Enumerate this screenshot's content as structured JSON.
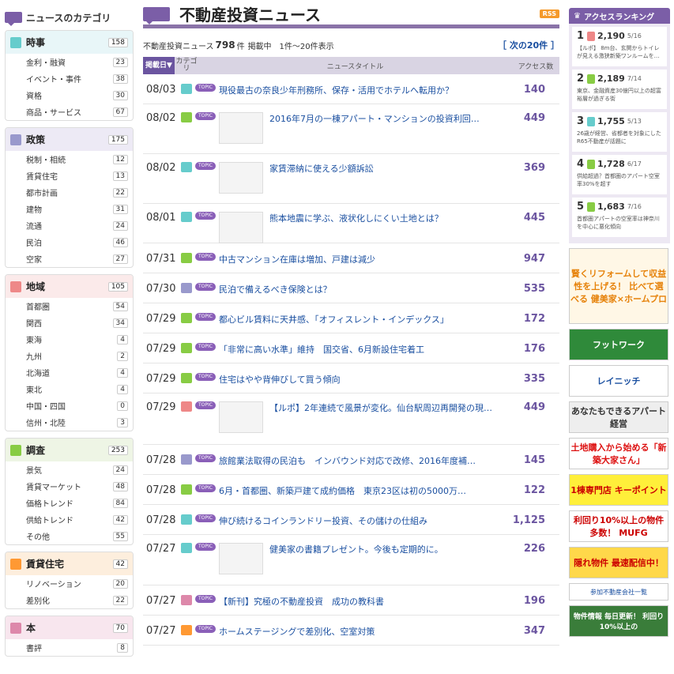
{
  "sidebar": {
    "title": "ニュースのカテゴリ",
    "categories": [
      {
        "name": "時事",
        "count": "158",
        "color": "#6cc",
        "ic": "時事",
        "bg": "#e8f6f8",
        "items": [
          {
            "label": "金利・融資",
            "count": "23"
          },
          {
            "label": "イベント・事件",
            "count": "38"
          },
          {
            "label": "資格",
            "count": "30"
          },
          {
            "label": "商品・サービス",
            "count": "67"
          }
        ]
      },
      {
        "name": "政策",
        "count": "175",
        "color": "#99c",
        "ic": "政策",
        "bg": "#edeaf5",
        "items": [
          {
            "label": "税制・相続",
            "count": "12"
          },
          {
            "label": "賃貸住宅",
            "count": "13"
          },
          {
            "label": "都市計画",
            "count": "22"
          },
          {
            "label": "建物",
            "count": "31"
          },
          {
            "label": "流通",
            "count": "24"
          },
          {
            "label": "民泊",
            "count": "46"
          },
          {
            "label": "空家",
            "count": "27"
          }
        ]
      },
      {
        "name": "地域",
        "count": "105",
        "color": "#e88",
        "ic": "地域",
        "bg": "#fbeaea",
        "items": [
          {
            "label": "首都圏",
            "count": "54"
          },
          {
            "label": "関西",
            "count": "34"
          },
          {
            "label": "東海",
            "count": "4"
          },
          {
            "label": "九州",
            "count": "2"
          },
          {
            "label": "北海道",
            "count": "4"
          },
          {
            "label": "東北",
            "count": "4"
          },
          {
            "label": "中国・四国",
            "count": "0"
          },
          {
            "label": "信州・北陸",
            "count": "3"
          }
        ]
      },
      {
        "name": "調査",
        "count": "253",
        "color": "#8c4",
        "ic": "調査",
        "bg": "#eef5e5",
        "items": [
          {
            "label": "景気",
            "count": "24"
          },
          {
            "label": "賃貸マーケット",
            "count": "48"
          },
          {
            "label": "価格トレンド",
            "count": "84"
          },
          {
            "label": "供給トレンド",
            "count": "42"
          },
          {
            "label": "その他",
            "count": "55"
          }
        ]
      },
      {
        "name": "賃貸住宅",
        "count": "42",
        "color": "#f93",
        "ic": "賃貸住宅",
        "bg": "#fdeedd",
        "items": [
          {
            "label": "リノベーション",
            "count": "20"
          },
          {
            "label": "差別化",
            "count": "22"
          }
        ]
      },
      {
        "name": "本",
        "count": "70",
        "color": "#d8a",
        "ic": "本",
        "bg": "#f8e6ee",
        "items": [
          {
            "label": "書評",
            "count": "8"
          }
        ]
      }
    ]
  },
  "main": {
    "title": "不動産投資ニュース",
    "rss": "RSS",
    "count_prefix": "不動産投資ニュース",
    "count_num": "798",
    "count_unit": "件",
    "count_suffix": "掲載中　1件〜20件表示",
    "next": "［ 次の20件 ］",
    "head": {
      "date": "掲載日▼",
      "cat": "カテゴリ",
      "title": "ニュースタイトル",
      "access": "アクセス数"
    },
    "rows": [
      {
        "date": "08/03",
        "color": "#6cc",
        "title": "現役最古の奈良少年刑務所、保存・活用でホテルへ転用か？",
        "access": "140",
        "thumb": false
      },
      {
        "date": "08/02",
        "color": "#8c4",
        "title": "2016年7月の一棟アパート・マンションの投資利回…",
        "access": "449",
        "thumb": true
      },
      {
        "date": "08/02",
        "color": "#6cc",
        "title": "家賃滞納に使える少額訴訟",
        "access": "369",
        "thumb": true
      },
      {
        "date": "08/01",
        "color": "#6cc",
        "title": "熊本地震に学ぶ、液状化しにくい土地とは？",
        "access": "445",
        "thumb": true
      },
      {
        "date": "07/31",
        "color": "#8c4",
        "title": "中古マンション在庫は増加、戸建は減少",
        "access": "947",
        "thumb": false
      },
      {
        "date": "07/30",
        "color": "#99c",
        "title": "民泊で備えるべき保険とは？",
        "access": "535",
        "thumb": false
      },
      {
        "date": "07/29",
        "color": "#8c4",
        "title": "都心ビル賃料に天井感、「オフィスレント・インデックス」",
        "access": "172",
        "thumb": false
      },
      {
        "date": "07/29",
        "color": "#8c4",
        "title": "「非常に高い水準」維持　国交省、6月新設住宅着工",
        "access": "176",
        "thumb": false
      },
      {
        "date": "07/29",
        "color": "#8c4",
        "title": "住宅はやや背伸びして買う傾向",
        "access": "335",
        "thumb": false
      },
      {
        "date": "07/29",
        "color": "#e88",
        "title": "【ルポ】2年連続で風景が変化。仙台駅周辺再開発の現…",
        "access": "449",
        "thumb": true
      },
      {
        "date": "07/28",
        "color": "#99c",
        "title": "旅館業法取得の民泊も　インバウンド対応で改修、2016年度補…",
        "access": "145",
        "thumb": false
      },
      {
        "date": "07/28",
        "color": "#8c4",
        "title": "6月・首都圏、新築戸建て成約価格　東京23区は初の5000万…",
        "access": "122",
        "thumb": false
      },
      {
        "date": "07/28",
        "color": "#6cc",
        "title": "伸び続けるコインランドリー投資、その儲けの仕組み",
        "access": "1,125",
        "thumb": false
      },
      {
        "date": "07/27",
        "color": "#6cc",
        "title": "健美家の書籍プレゼント。今後も定期的に。",
        "access": "226",
        "thumb": true
      },
      {
        "date": "07/27",
        "color": "#d8a",
        "title": "【新刊】究極の不動産投資　成功の教科書",
        "access": "196",
        "thumb": false
      },
      {
        "date": "07/27",
        "color": "#f93",
        "title": "ホームステージングで差別化、空室対策",
        "access": "347",
        "thumb": false
      }
    ]
  },
  "ranking": {
    "title": "アクセスランキング",
    "items": [
      {
        "no": "1",
        "value": "2,190",
        "date": "5/16",
        "desc": "【ルポ】 8m台、玄関からトイレが見える激狭新築ワンルームを…"
      },
      {
        "no": "2",
        "value": "2,189",
        "date": "7/14",
        "desc": "東京、金融資産30億円以上の超富裕層が過ぎる街"
      },
      {
        "no": "3",
        "value": "1,755",
        "date": "5/13",
        "desc": "26歳が経営、省都者を対象にしたR65不動産が話題に"
      },
      {
        "no": "4",
        "value": "1,728",
        "date": "6/17",
        "desc": "供給超過？首都圏のアパート空室率30%を超す"
      },
      {
        "no": "5",
        "value": "1,683",
        "date": "7/16",
        "desc": "首都圏アパートの空室率は神奈川を中心に悪化傾向"
      }
    ]
  },
  "ads": [
    {
      "text": "賢くリフォームして収益性を上げる！ 比べて選べる 健美家×ホームプロ",
      "h": 96,
      "bg": "#fff7e6",
      "color": "#e6820a"
    },
    {
      "text": "フットワーク",
      "h": 40,
      "bg": "#2f8a3a",
      "color": "#fff"
    },
    {
      "text": "レイニッチ",
      "h": 40,
      "bg": "#fff",
      "color": "#1a4fa0"
    },
    {
      "text": "あなたもできるアパート経営",
      "h": 40,
      "bg": "#eee",
      "color": "#333"
    },
    {
      "text": "土地購入から始める「新築大家さん」",
      "h": 40,
      "bg": "#fff",
      "color": "#d11"
    },
    {
      "text": "1棟専門店 キーポイント",
      "h": 40,
      "bg": "#ffef3a",
      "color": "#c00"
    },
    {
      "text": "利回り10%以上の物件多数！ MUFG",
      "h": 40,
      "bg": "#fff",
      "color": "#c00"
    },
    {
      "text": "隠れ物件 最速配信中！",
      "h": 40,
      "bg": "#ffd84a",
      "color": "#c00"
    }
  ],
  "link": "参加不動産会社一覧",
  "bottom_ad": {
    "text": "物件情報 毎日更新！ 利回り10%以上の",
    "bg": "#3a7d3a"
  }
}
